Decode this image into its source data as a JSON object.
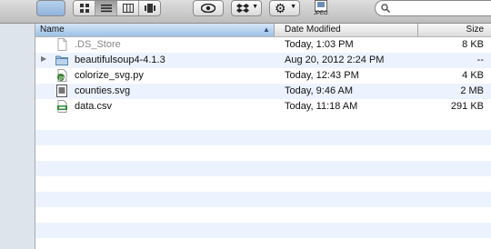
{
  "columns": {
    "name": "Name",
    "date": "Date Modified",
    "size": "Size"
  },
  "files": [
    {
      "name": ".DS_Store",
      "date": "Today, 1:03 PM",
      "size": "8 KB",
      "icon": "blank-document-icon"
    },
    {
      "name": "beautifulsoup4-4.1.3",
      "date": "Aug 20, 2012 2:24 PM",
      "size": "--",
      "icon": "folder-icon"
    },
    {
      "name": "colorize_svg.py",
      "date": "Today, 12:43 PM",
      "size": "4 KB",
      "icon": "python-file-icon"
    },
    {
      "name": "counties.svg",
      "date": "Today, 9:46 AM",
      "size": "2 MB",
      "icon": "svg-file-icon"
    },
    {
      "name": "data.csv",
      "date": "Today, 11:18 AM",
      "size": "291 KB",
      "icon": "csv-file-icon"
    }
  ],
  "toolbar": {
    "jpeg_label": "JPEG"
  },
  "colors": {
    "selected_header": "#9cc0e6",
    "row_stripe": "#edf3fe",
    "sidebar": "#dde4eb"
  }
}
